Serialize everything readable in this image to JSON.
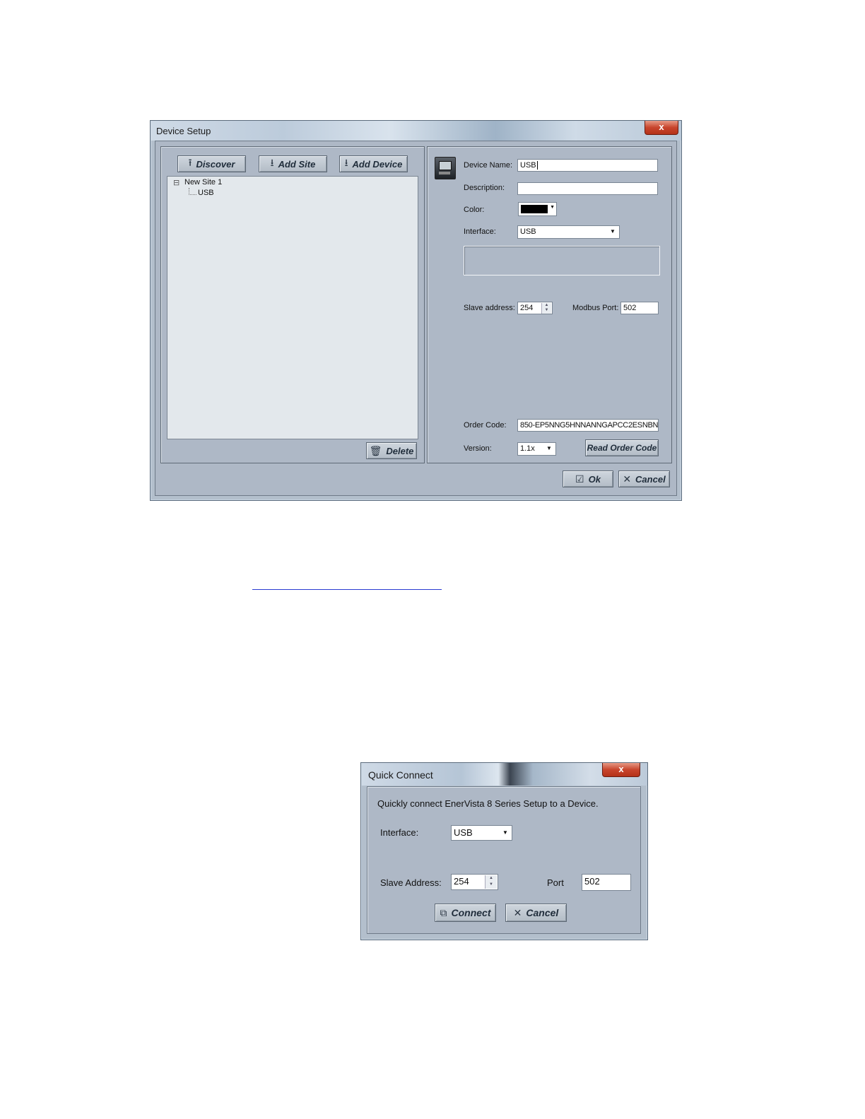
{
  "device_setup": {
    "title": "Device Setup",
    "close_label": "x",
    "toolbar": {
      "discover": "Discover",
      "add_site": "Add Site",
      "add_device": "Add Device"
    },
    "tree": {
      "expander": "⊟",
      "site": "New Site 1",
      "device": "USB"
    },
    "delete_label": "Delete",
    "form": {
      "device_name_label": "Device Name:",
      "device_name_value": "USB",
      "description_label": "Description:",
      "description_value": "",
      "color_label": "Color:",
      "color_value": "#000000",
      "interface_label": "Interface:",
      "interface_value": "USB",
      "slave_address_label": "Slave address:",
      "slave_address_value": "254",
      "modbus_port_label": "Modbus Port:",
      "modbus_port_value": "502",
      "order_code_label": "Order Code:",
      "order_code_value": "850-EP5NNG5HNNANNGAPCC2ESNBN",
      "version_label": "Version:",
      "version_value": "1.1x",
      "read_order_code": "Read Order Code"
    },
    "ok_label": "Ok",
    "cancel_label": "Cancel"
  },
  "quick_connect": {
    "title": "Quick Connect",
    "close_label": "x",
    "message": "Quickly connect EnerVista 8 Series Setup to a Device.",
    "interface_label": "Interface:",
    "interface_value": "USB",
    "slave_address_label": "Slave Address:",
    "slave_address_value": "254",
    "port_label": "Port",
    "port_value": "502",
    "connect_label": "Connect",
    "cancel_label": "Cancel"
  },
  "colors": {
    "dialog_bg": "#aeb8c6",
    "tree_bg": "#e3e8ec",
    "link_underline": "#2a3bd1",
    "close_red": "#c8452d"
  }
}
